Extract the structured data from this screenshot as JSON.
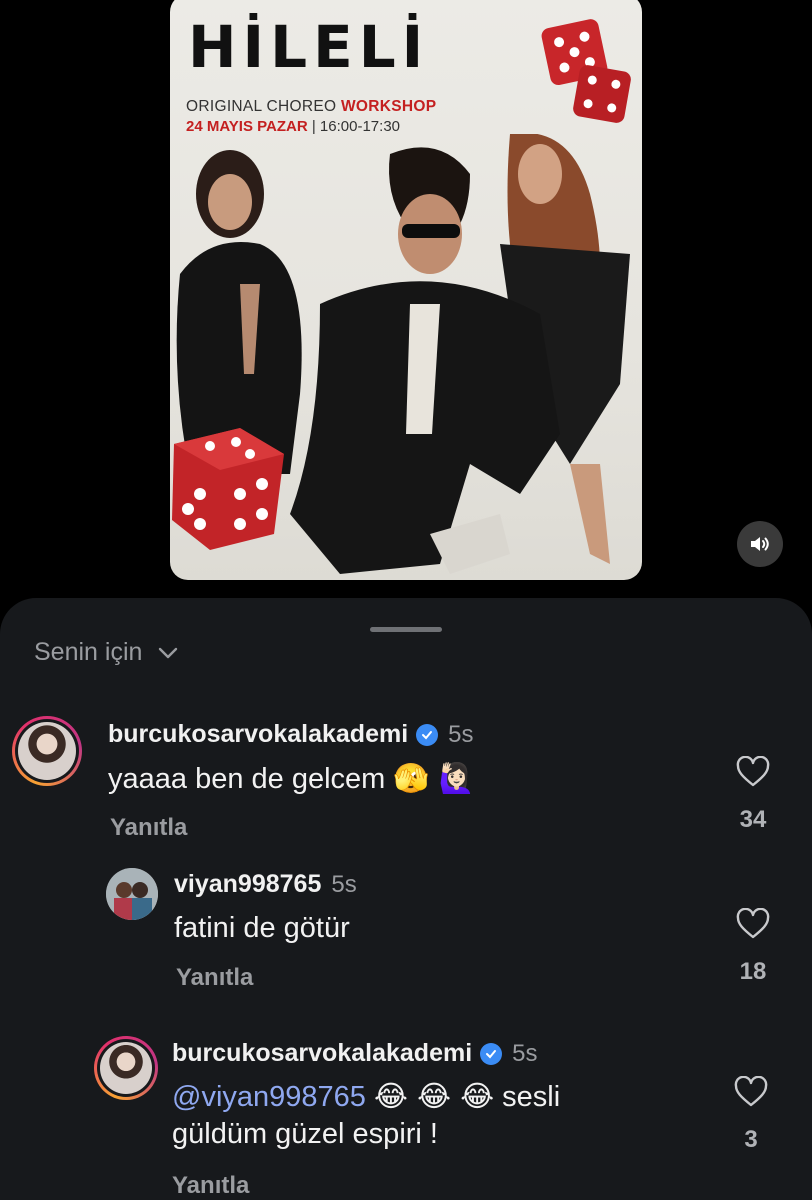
{
  "poster": {
    "title": "HİLELİ",
    "subtitle_plain": "ORIGINAL CHOREO ",
    "subtitle_accent": "WORKSHOP",
    "date_accent": "24 MAYIS PAZAR",
    "date_plain": " | 16:00-17:30"
  },
  "sheet": {
    "sort_label": "Senin için"
  },
  "comments": [
    {
      "username": "burcukosarvokalakademi",
      "verified": true,
      "time": "5s",
      "text": "yaaaa ben de gelcem",
      "emojis": "🫣 🙋🏻‍♀️",
      "reply_label": "Yanıtla",
      "likes": "34"
    },
    {
      "username": "viyan998765",
      "verified": false,
      "time": "5s",
      "text": "fatini de götür",
      "reply_label": "Yanıtla",
      "likes": "18"
    },
    {
      "username": "burcukosarvokalakademi",
      "verified": true,
      "time": "5s",
      "mention": "@viyan998765",
      "emojis": "😂 😂 😂",
      "text_line1_tail": "sesli",
      "text_line2": "güldüm güzel espiri !",
      "reply_label": "Yanıtla",
      "likes": "3"
    }
  ],
  "icons": {
    "sound": "speaker-icon",
    "heart": "heart-outline-icon",
    "sort_chevron": "chevron-down-icon",
    "verified": "verified-badge-icon"
  },
  "colors": {
    "sheet_bg": "#17191c",
    "accent_red": "#c42020",
    "mention": "#8fa8f0",
    "verified": "#3b8cf5"
  }
}
